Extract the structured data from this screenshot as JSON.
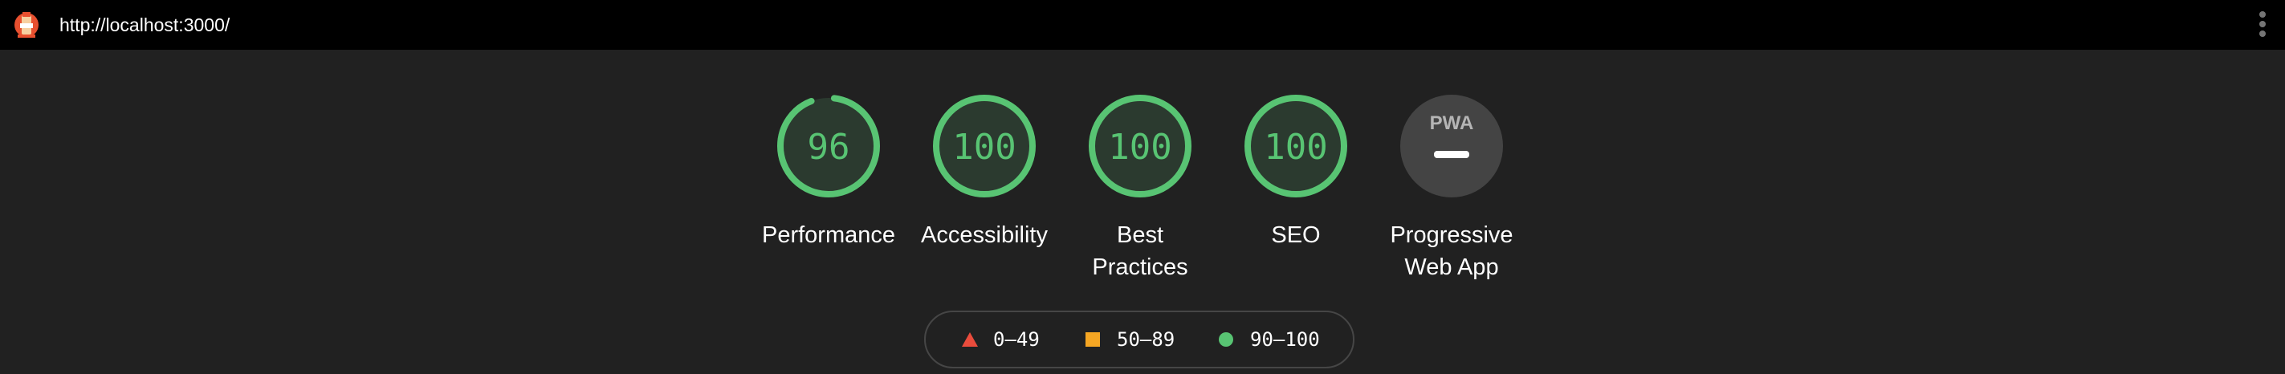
{
  "header": {
    "url": "http://localhost:3000/",
    "logo_icon": "lighthouse-icon",
    "menu_icon": "kebab-menu-icon"
  },
  "gauges": [
    {
      "label": "Performance",
      "score": "96",
      "fraction": 0.96,
      "color": "#58c473"
    },
    {
      "label": "Accessibility",
      "score": "100",
      "fraction": 1.0,
      "color": "#58c473"
    },
    {
      "label_lines": [
        "Best",
        "Practices"
      ],
      "score": "100",
      "fraction": 1.0,
      "color": "#58c473"
    },
    {
      "label": "SEO",
      "score": "100",
      "fraction": 1.0,
      "color": "#58c473"
    },
    {
      "label_lines": [
        "Progressive",
        "Web App"
      ],
      "badge_text": "PWA",
      "icon": "pwa-badge-icon"
    }
  ],
  "legend": [
    {
      "range": "0–49",
      "icon": "triangle-icon",
      "color": "#ea4c3c"
    },
    {
      "range": "50–89",
      "icon": "square-icon",
      "color": "#f5a623"
    },
    {
      "range": "90–100",
      "icon": "circle-icon",
      "color": "#58c473"
    }
  ]
}
